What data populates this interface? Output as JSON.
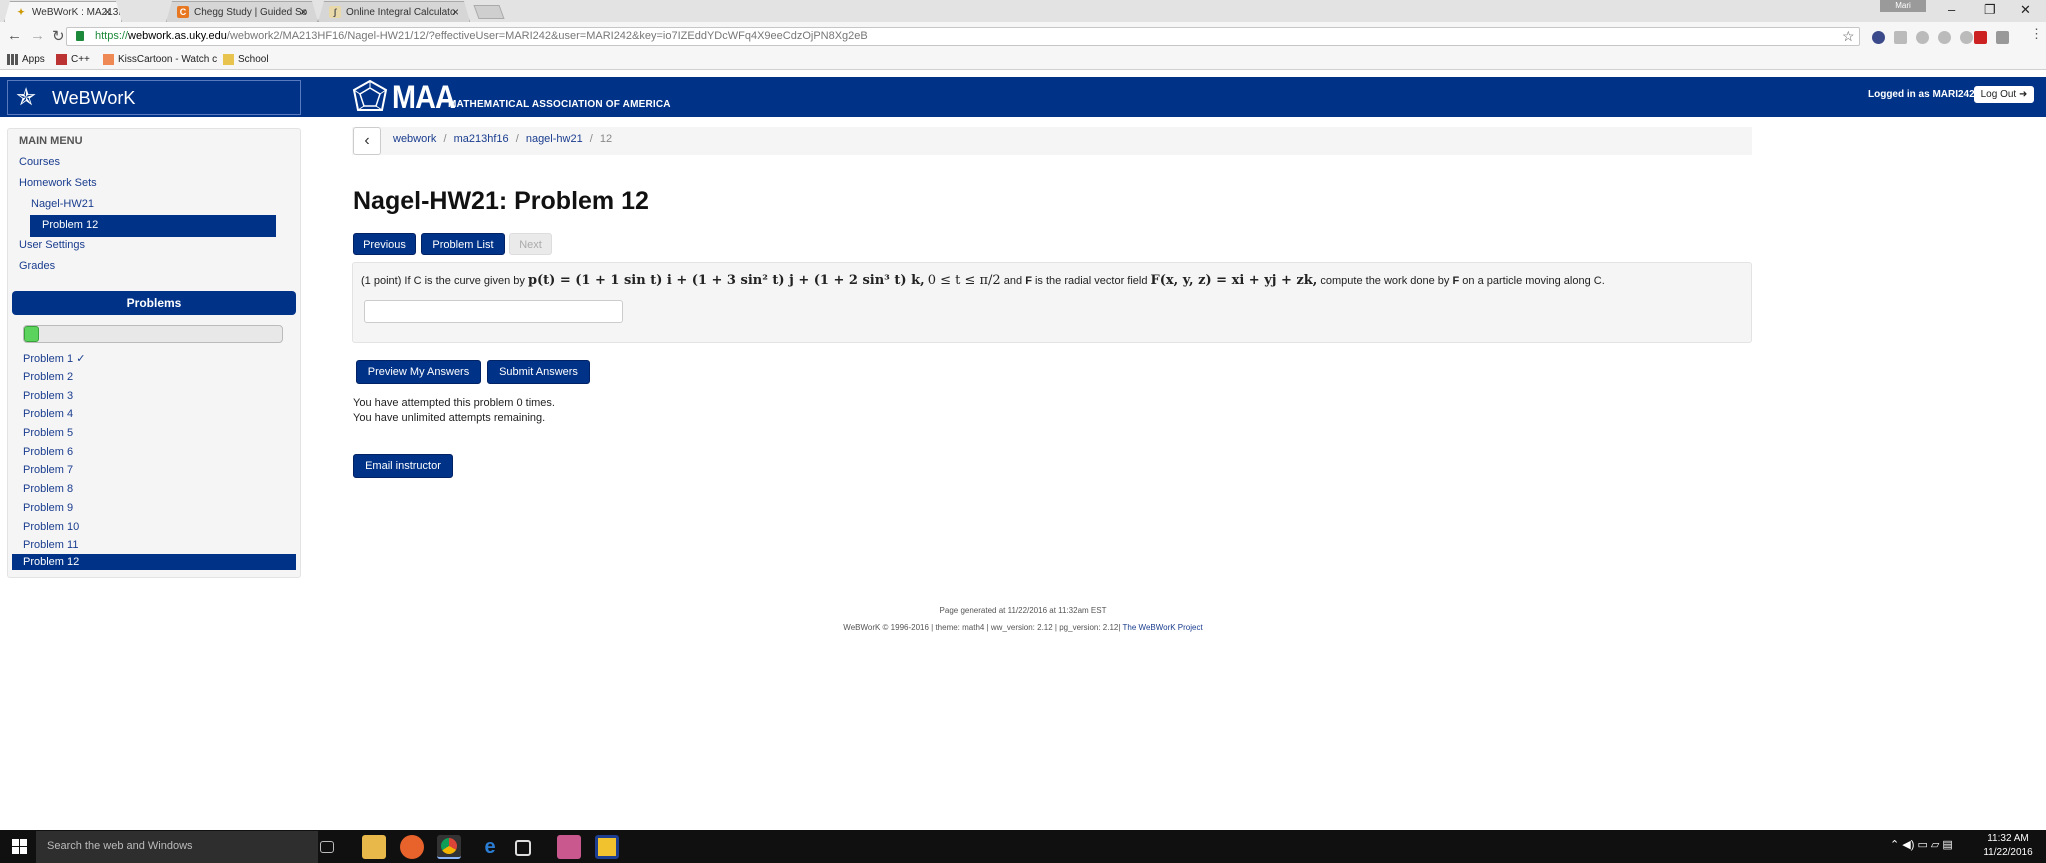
{
  "browser": {
    "tabs": [
      {
        "title": "WeBWorK : MA213HF16",
        "active": true
      },
      {
        "title": "Chegg Study | Guided So",
        "active": false
      },
      {
        "title": "Online Integral Calculato",
        "active": false
      }
    ],
    "profile_name": "Mari",
    "url": {
      "scheme": "https://",
      "host": "webwork.as.uky.edu",
      "path": "/webwork2/MA213HF16/Nagel-HW21/12/?effectiveUser=MARI242&user=MARI242&key=io7IZEddYDcWFq4X9eeCdzOjPN8Xg2eB"
    },
    "bookmarks": [
      "Apps",
      "C++",
      "KissCartoon - Watch c",
      "School"
    ]
  },
  "header": {
    "brand": "WeBWorK",
    "maa_acronym": "MAA",
    "maa_full": "MATHEMATICAL ASSOCIATION OF AMERICA",
    "logged_in": "Logged in as MARI242.",
    "logout_label": "Log Out"
  },
  "sidebar": {
    "main_menu_title": "MAIN MENU",
    "links": {
      "courses": "Courses",
      "homework_sets": "Homework Sets",
      "set_name": "Nagel-HW21",
      "current_problem": "Problem 12",
      "user_settings": "User Settings",
      "grades": "Grades"
    },
    "problems_title": "Problems",
    "progress_fraction": 0.06,
    "problems": [
      "Problem 1 ✓",
      "Problem 2",
      "Problem 3",
      "Problem 4",
      "Problem 5",
      "Problem 6",
      "Problem 7",
      "Problem 8",
      "Problem 9",
      "Problem 10",
      "Problem 11",
      "Problem 12"
    ]
  },
  "breadcrumb": {
    "items": [
      "webwork",
      "ma213hf16",
      "nagel-hw21",
      "12"
    ],
    "separator": "/"
  },
  "main": {
    "title": "Nagel-HW21: Problem 12",
    "nav": {
      "previous": "Previous",
      "problem_list": "Problem List",
      "next": "Next"
    },
    "problem": {
      "points": "(1 point)",
      "text_1": "If C is the curve given by",
      "curve_eq": "p(t) = (1 + 1 sin t) i + (1 + 3 sin² t) j + (1 + 2 sin³ t) k,",
      "range": "0 ≤ t ≤ π/2",
      "text_2": "and",
      "F_bold": "F",
      "text_3": "is the radial vector field",
      "field_eq": "F(x, y, z) = xi + yj + zk,",
      "text_4": "compute the work done by",
      "text_5": "on a particle moving along C.",
      "answer_value": ""
    },
    "buttons": {
      "preview": "Preview My Answers",
      "submit": "Submit Answers",
      "email": "Email instructor"
    },
    "attempts_line_1": "You have attempted this problem 0 times.",
    "attempts_line_2": "You have unlimited attempts remaining."
  },
  "footer": {
    "generated": "Page generated at 11/22/2016 at 11:32am EST",
    "version_prefix": "WeBWorK © 1996-2016 | theme: math4 | ww_version: 2.12 | pg_version: 2.12|",
    "project_link": "The WeBWorK Project"
  },
  "taskbar": {
    "search_placeholder": "Search the web and Windows",
    "time": "11:32 AM",
    "date": "11/22/2016"
  },
  "colors": {
    "brand_blue": "#003388",
    "progress_green": "#5cd35c"
  }
}
